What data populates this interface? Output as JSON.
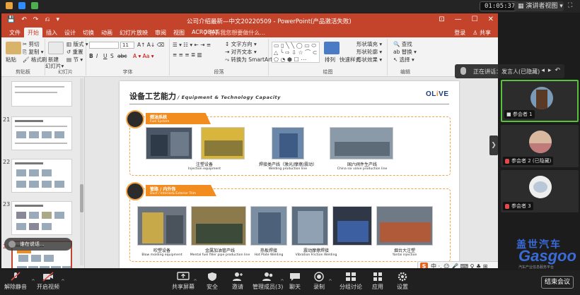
{
  "zoom_top": {
    "timer": "01:05:37",
    "view_button": "演讲者视图",
    "fullscreen": "⛶"
  },
  "ppt": {
    "window_title": "公司介绍最新—中文20220509 - PowerPoint(产品激活失败)",
    "qat": [
      "💾",
      "↶",
      "↷",
      "⎌",
      "▾"
    ],
    "win_controls": [
      "⊡",
      "—",
      "☐",
      "✕"
    ],
    "tabs": [
      "文件",
      "开始",
      "插入",
      "设计",
      "切换",
      "动画",
      "幻灯片放映",
      "审阅",
      "视图",
      "ACROBAT"
    ],
    "active_tab": "开始",
    "tell_me": "♀ 告诉我您想要做什么...",
    "login": "登录",
    "share": "♙ 共享",
    "ribbon": {
      "paste": "粘贴",
      "cut": "✂ 剪切",
      "copy": "⎘ 复制 ▾",
      "format_painter": "🖌 格式刷",
      "new_slide": "新建",
      "new_slide2": "幻灯片▾",
      "layout": "▥ 版式 ▾",
      "reset": "↺ 重置",
      "section": "▤ 节 ▾",
      "font_size": "11",
      "text_direction": "↕ 文字方向 ▾",
      "align_text": "⇥ 对齐文本 ▾",
      "smartart": "⤳ 转换为 SmartArt ▾",
      "arrange": "排列",
      "quick_styles": "快速样式",
      "shape_fill": "形状填充 ▾",
      "shape_outline": "形状轮廓 ▾",
      "shape_effects": "形状效果 ▾",
      "find": "🔍 查找",
      "replace": "ab 替换 ▾",
      "select": "↖ 选择 ▾",
      "bold": "B",
      "italic": "I",
      "underline": "U",
      "strike": "S",
      "abc": "abc",
      "groups": [
        "剪贴板",
        "幻灯片",
        "字体",
        "段落",
        "绘图",
        "编辑"
      ]
    },
    "thumbnails": [
      {
        "num": "21"
      },
      {
        "num": "22"
      },
      {
        "num": "23"
      },
      {
        "num": "24"
      }
    ],
    "thumb_tooltip": "谁在说话...",
    "slide": {
      "title_cn": "设备工艺能力",
      "title_en": "/ Equipment & Technology Capacity",
      "logo_a": "OL",
      "logo_b": "i",
      "logo_c": "VE",
      "sections": [
        {
          "cn": "燃油系统",
          "en": "Fuel System",
          "items": [
            {
              "cn": "注塑设备",
              "en": "Injection equipment"
            },
            {
              "cn": "焊接类产线（激光/摩擦/震动）",
              "en": "Welding production line"
            },
            {
              "cn": "国六阀件生产线",
              "en": "China six valve production line"
            }
          ]
        },
        {
          "cn": "管路 / 内外饰",
          "en": "Duct / Interior& Exterior Trim",
          "items": [
            {
              "cn": "吹塑设备",
              "en": "Blow molding equipment"
            },
            {
              "cn": "金属加油管产线",
              "en": "Mental fuel filler pipe production line"
            },
            {
              "cn": "热板焊接",
              "en": "Hot Plate Welding"
            },
            {
              "cn": "震动摩擦焊接",
              "en": "Vibration Friction Welding"
            },
            {
              "cn": "烟台大注塑",
              "en": "Yantai injection"
            }
          ]
        }
      ]
    },
    "ime": {
      "logo": "S",
      "text": "中 ·, ☺ 🎤 ⌨ ♀ ♣ ⊞"
    },
    "side_arrow": "❯"
  },
  "speaker_chip": {
    "name": "正在讲话：发言人(已隐藏)",
    "controls": [
      "◂",
      "▸",
      "↶"
    ]
  },
  "participants": [
    {
      "name": "■ 参会者 1",
      "mic_off": false,
      "active": true
    },
    {
      "name": "参会者 2 (已隐藏)",
      "mic_off": true,
      "active": false
    },
    {
      "name": "参会者 3",
      "mic_off": true,
      "active": false
    }
  ],
  "watermark": {
    "cn": "盖世汽车",
    "en": "Gasgoo",
    "sub": "汽车产业信息服务平台"
  },
  "toolbar": {
    "unmute": "解除静音",
    "start_video": "开启视频",
    "share_screen": "共享屏幕",
    "security": "安全",
    "invite": "邀请",
    "participants": "管理成员(3)",
    "chat": "聊天",
    "record": "录制",
    "breakout": "分组讨论",
    "apps": "应用",
    "settings": "设置",
    "end": "结束会议"
  },
  "colors": {
    "ppt_accent": "#c4432b",
    "olive_orange": "#f28c1e",
    "zoom_green": "#59c23c",
    "gasgoo_blue": "#3a6bd8"
  }
}
